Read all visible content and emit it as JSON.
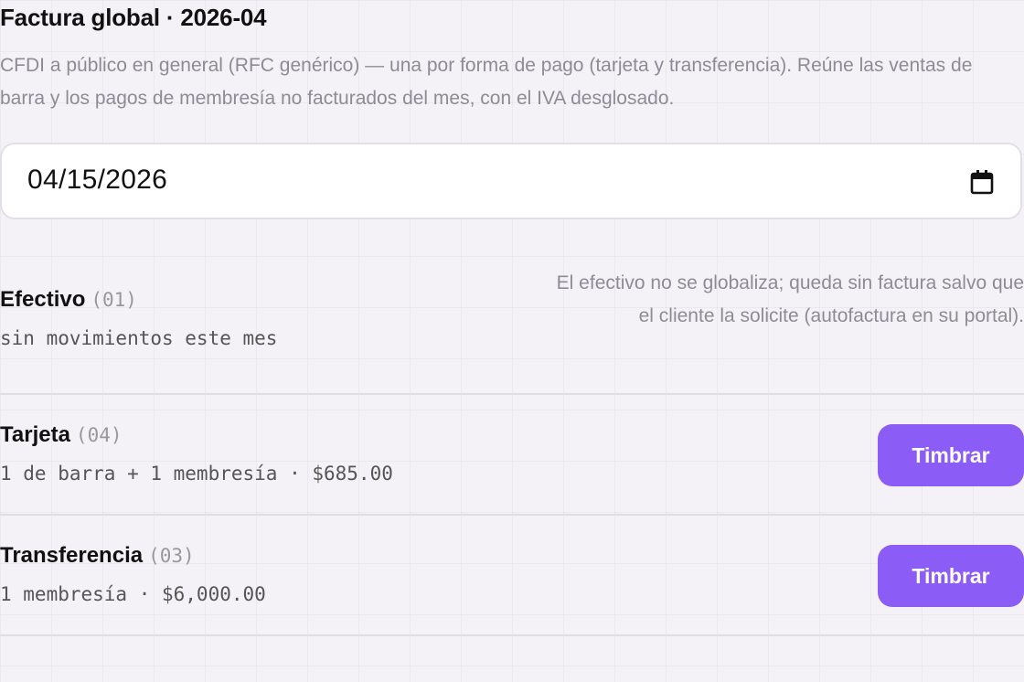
{
  "header": {
    "title": "Factura global · 2026-04",
    "description": "CFDI a público en general (RFC genérico) — una por forma de pago (tarjeta y transferencia). Reúne las ventas de barra y los pagos de membresía no facturados del mes, con el IVA desglosado."
  },
  "date_field": {
    "value": "04/15/2026",
    "icon": "calendar-icon"
  },
  "rows": [
    {
      "name": "Efectivo",
      "code": "(01)",
      "detail": "sin movimientos este mes",
      "note": "El efectivo no se globaliza; queda sin factura salvo que el cliente la solicite (autofactura en su portal)."
    },
    {
      "name": "Tarjeta",
      "code": "(04)",
      "detail": "1 de barra + 1 membresía · $685.00",
      "button": "Timbrar"
    },
    {
      "name": "Transferencia",
      "code": "(03)",
      "detail": "1 membresía · $6,000.00",
      "button": "Timbrar"
    }
  ],
  "colors": {
    "accent": "#8b5cf6",
    "background": "#f4f2f6",
    "muted_text": "#8f8b96"
  }
}
